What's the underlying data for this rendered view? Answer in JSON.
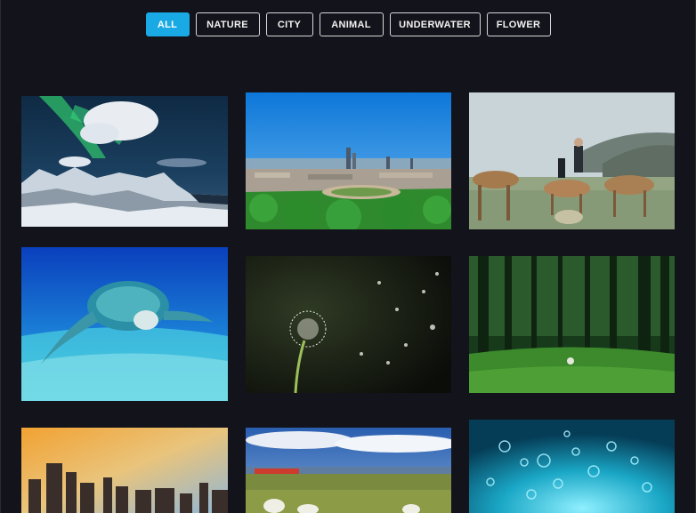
{
  "filters": {
    "all": "ALL",
    "nature": "NATURE",
    "city": "CITY",
    "animal": "ANIMAL",
    "underwater": "UNDERWATER",
    "flower": "FLOWER",
    "active": "ALL"
  },
  "colors": {
    "background": "#13131b",
    "accent": "#19a9e4",
    "button_border": "#d8d8d8"
  }
}
